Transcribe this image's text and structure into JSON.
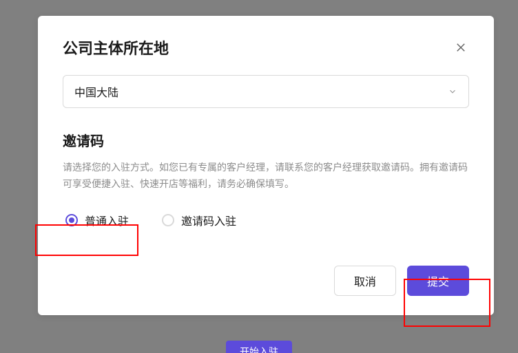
{
  "modal": {
    "title": "公司主体所在地",
    "select": {
      "value": "中国大陆"
    },
    "invite_section": {
      "title": "邀请码",
      "description": "请选择您的入驻方式。如您已有专属的客户经理，请联系您的客户经理获取邀请码。拥有邀请码可享受便捷入驻、快速开店等福利，请务必确保填写。"
    },
    "radio_options": {
      "regular": "普通入驻",
      "invite_code": "邀请码入驻"
    },
    "buttons": {
      "cancel": "取消",
      "submit": "提交"
    }
  },
  "background_button": "开始入驻"
}
